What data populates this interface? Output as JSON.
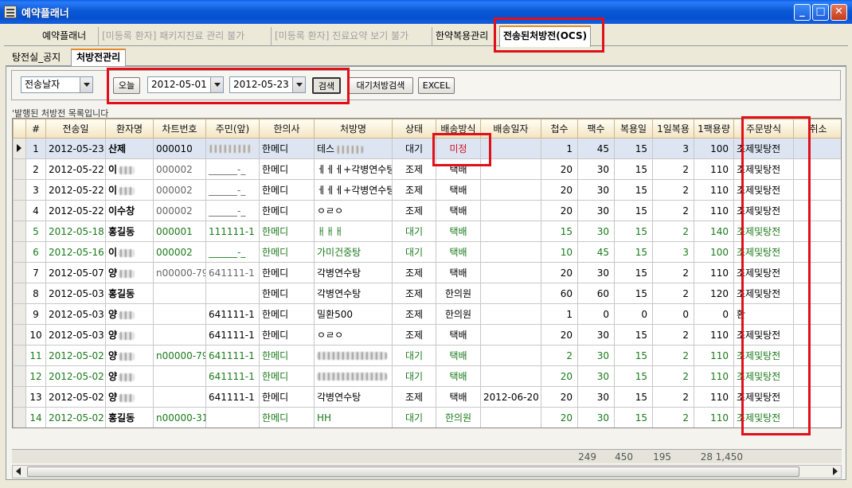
{
  "window": {
    "title": "예약플래너"
  },
  "top_tabs": [
    {
      "label": "예약플래너"
    },
    {
      "label": "[미등록 환자] 패키지진료 관리 불가"
    },
    {
      "label": "[미등록 환자] 진료요약 보기 불가"
    },
    {
      "label": "한약복용관리"
    },
    {
      "label": "전송된처방전(OCS)"
    }
  ],
  "sub_tabs": [
    {
      "label": "탕전실_공지"
    },
    {
      "label": "처방전관리"
    }
  ],
  "toolbar": {
    "date_type": "전송날자",
    "today_label": "오늘",
    "date_from": "2012-05-01",
    "date_to": "2012-05-23",
    "search_label": "검색",
    "waiting_search_label": "대기처방검색",
    "excel_label": "EXCEL"
  },
  "list_caption": "'발행된 처방전 목록입니다",
  "columns": [
    "#",
    "전송일",
    "환자명",
    "차트번호",
    "주민(앞)",
    "한의사",
    "처방명",
    "상태",
    "배송방식",
    "배송일자",
    "첩수",
    "팩수",
    "복용일",
    "1일복용",
    "1팩용량",
    "주문방식",
    "취소"
  ],
  "rows": [
    {
      "no": "1",
      "date": "2012-05-23",
      "patient": "산제",
      "chart": "000010",
      "jumin": "",
      "doctor": "한메디",
      "rx": "테스",
      "status": "대기",
      "delivery": "미정",
      "ship_date": "",
      "cheop": "1",
      "pack": "45",
      "days": "15",
      "daily": "3",
      "vol": "100",
      "order": "조제및탕전"
    },
    {
      "no": "2",
      "date": "2012-05-22",
      "patient": "이",
      "chart": "000002",
      "jumin": "______-_",
      "doctor": "한메디",
      "rx": "ㅔㅔㅔ+각병연수탕",
      "status": "조제",
      "delivery": "택배",
      "ship_date": "",
      "cheop": "20",
      "pack": "30",
      "days": "15",
      "daily": "2",
      "vol": "110",
      "order": "조제및탕전"
    },
    {
      "no": "3",
      "date": "2012-05-22",
      "patient": "이",
      "chart": "000002",
      "jumin": "______-_",
      "doctor": "한메디",
      "rx": "ㅔㅔㅔ+각병연수탕",
      "status": "조제",
      "delivery": "택배",
      "ship_date": "",
      "cheop": "20",
      "pack": "30",
      "days": "15",
      "daily": "2",
      "vol": "110",
      "order": "조제및탕전"
    },
    {
      "no": "4",
      "date": "2012-05-22",
      "patient": "이수창",
      "chart": "000002",
      "jumin": "______-_",
      "doctor": "한메디",
      "rx": "ㅇㄹㅇ",
      "status": "조제",
      "delivery": "택배",
      "ship_date": "",
      "cheop": "20",
      "pack": "30",
      "days": "15",
      "daily": "2",
      "vol": "110",
      "order": "조제및탕전"
    },
    {
      "no": "5",
      "date": "2012-05-18",
      "patient": "홍길동",
      "chart": "000001",
      "jumin": "111111-1",
      "doctor": "한메디",
      "rx": "ㅐㅐㅐ",
      "status": "대기",
      "delivery": "택배",
      "ship_date": "",
      "cheop": "15",
      "pack": "30",
      "days": "15",
      "daily": "2",
      "vol": "140",
      "order": "조제및탕전"
    },
    {
      "no": "6",
      "date": "2012-05-16",
      "patient": "이",
      "chart": "000002",
      "jumin": "______-_",
      "doctor": "한메디",
      "rx": "가미건중탕",
      "status": "대기",
      "delivery": "택배",
      "ship_date": "",
      "cheop": "10",
      "pack": "45",
      "days": "15",
      "daily": "3",
      "vol": "100",
      "order": "조제및탕전"
    },
    {
      "no": "7",
      "date": "2012-05-07",
      "patient": "양",
      "chart": "n00000-79",
      "jumin": "641111-1",
      "doctor": "한메디",
      "rx": "각병연수탕",
      "status": "조제",
      "delivery": "택배",
      "ship_date": "",
      "cheop": "20",
      "pack": "30",
      "days": "15",
      "daily": "2",
      "vol": "110",
      "order": "조제및탕전"
    },
    {
      "no": "8",
      "date": "2012-05-03",
      "patient": "홍길동",
      "chart": "",
      "jumin": "",
      "doctor": "한메디",
      "rx": "각병연수탕",
      "status": "조제",
      "delivery": "한의원",
      "ship_date": "",
      "cheop": "60",
      "pack": "60",
      "days": "15",
      "daily": "2",
      "vol": "120",
      "order": "조제및탕전"
    },
    {
      "no": "9",
      "date": "2012-05-03",
      "patient": "양",
      "chart": "",
      "jumin": "641111-1",
      "doctor": "한메디",
      "rx": "밀환500",
      "status": "조제",
      "delivery": "한의원",
      "ship_date": "",
      "cheop": "1",
      "pack": "0",
      "days": "0",
      "daily": "0",
      "vol": "0",
      "order": "환"
    },
    {
      "no": "10",
      "date": "2012-05-03",
      "patient": "양",
      "chart": "",
      "jumin": "641111-1",
      "doctor": "한메디",
      "rx": "ㅇㄹㅇ",
      "status": "조제",
      "delivery": "택배",
      "ship_date": "",
      "cheop": "20",
      "pack": "30",
      "days": "15",
      "daily": "2",
      "vol": "110",
      "order": "조제및탕전"
    },
    {
      "no": "11",
      "date": "2012-05-02",
      "patient": "양",
      "chart": "n00000-79",
      "jumin": "641111-1",
      "doctor": "한메디",
      "rx": "",
      "status": "대기",
      "delivery": "택배",
      "ship_date": "",
      "cheop": "2",
      "pack": "30",
      "days": "15",
      "daily": "2",
      "vol": "110",
      "order": "조제및탕전"
    },
    {
      "no": "12",
      "date": "2012-05-02",
      "patient": "양",
      "chart": "",
      "jumin": "641111-1",
      "doctor": "한메디",
      "rx": "",
      "status": "대기",
      "delivery": "택배",
      "ship_date": "",
      "cheop": "20",
      "pack": "30",
      "days": "15",
      "daily": "2",
      "vol": "110",
      "order": "조제및탕전"
    },
    {
      "no": "13",
      "date": "2012-05-02",
      "patient": "양",
      "chart": "",
      "jumin": "641111-1",
      "doctor": "한메디",
      "rx": "각병연수탕",
      "status": "조제",
      "delivery": "택배",
      "ship_date": "2012-06-20",
      "cheop": "20",
      "pack": "30",
      "days": "15",
      "daily": "2",
      "vol": "110",
      "order": "조제및탕전"
    },
    {
      "no": "14",
      "date": "2012-05-02",
      "patient": "홍길동",
      "chart": "n00000-31",
      "jumin": "",
      "doctor": "한메디",
      "rx": "HH",
      "status": "대기",
      "delivery": "한의원",
      "ship_date": "",
      "cheop": "20",
      "pack": "30",
      "days": "15",
      "daily": "2",
      "vol": "110",
      "order": "조제및탕전"
    }
  ],
  "totals": {
    "cheop": "249",
    "pack": "450",
    "days": "195",
    "daily": "28",
    "vol": "1,450"
  },
  "colors": {
    "highlight_box": "#e0101a",
    "green_text": "#1a7a1a",
    "red_text": "#d01020"
  }
}
